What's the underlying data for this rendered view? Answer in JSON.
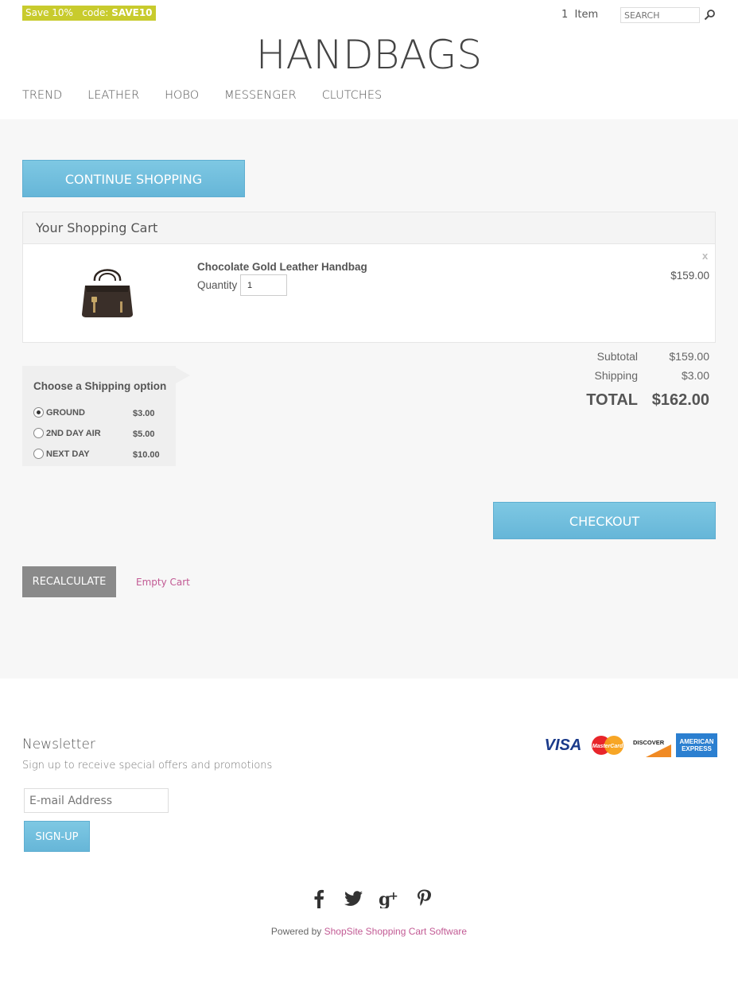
{
  "header": {
    "promo_text": "Save 10%",
    "promo_code_label": "code:",
    "promo_code": "SAVE10",
    "cart_count": "1",
    "cart_count_label": "Item",
    "search_placeholder": "SEARCH",
    "logo": "HANDBAGS",
    "nav": [
      {
        "label": "TREND"
      },
      {
        "label": "LEATHER"
      },
      {
        "label": "HOBO"
      },
      {
        "label": "MESSENGER"
      },
      {
        "label": "CLUTCHES"
      }
    ]
  },
  "cart": {
    "continue_label": "CONTINUE SHOPPING",
    "title": "Your Shopping Cart",
    "items": [
      {
        "name": "Chocolate Gold Leather Handbag",
        "quantity_label": "Quantity",
        "quantity": "1",
        "price": "$159.00",
        "remove_label": "x"
      }
    ],
    "subtotal_label": "Subtotal",
    "subtotal": "$159.00",
    "shipping_label": "Shipping",
    "shipping": "$3.00",
    "total_label": "TOTAL",
    "total": "$162.00",
    "shipping_options_title": "Choose a Shipping option",
    "shipping_options": [
      {
        "label": "GROUND",
        "price": "$3.00",
        "selected": true
      },
      {
        "label": "2ND DAY AIR",
        "price": "$5.00",
        "selected": false
      },
      {
        "label": "NEXT DAY",
        "price": "$10.00",
        "selected": false
      }
    ],
    "checkout_label": "CHECKOUT",
    "recalculate_label": "RECALCULATE",
    "empty_cart_label": "Empty Cart"
  },
  "footer": {
    "newsletter_title": "Newsletter",
    "newsletter_sub": "Sign up to receive special offers and promotions",
    "email_placeholder": "E-mail Address",
    "signup_label": "SIGN-UP",
    "cards": [
      "visa-icon",
      "mastercard-icon",
      "discover-icon",
      "amex-icon"
    ],
    "card_text": {
      "visa": "VISA",
      "mastercard": "MasterCard",
      "discover": "DISCOVER",
      "amex_line1": "AMERICAN",
      "amex_line2": "EXPRESS"
    },
    "social": [
      {
        "icon": "facebook-icon",
        "glyph": "f"
      },
      {
        "icon": "twitter-icon",
        "glyph": "t"
      },
      {
        "icon": "google-plus-icon",
        "glyph": "g+"
      },
      {
        "icon": "pinterest-icon",
        "glyph": "p"
      }
    ],
    "powered_prefix": "Powered by",
    "powered_link": "ShopSite Shopping Cart Software"
  },
  "colors": {
    "accent_blue": "#6fbfdf",
    "promo_green": "#c8cb2d",
    "link_pink": "#c25a94",
    "recalc_grey": "#8a8a8a"
  }
}
